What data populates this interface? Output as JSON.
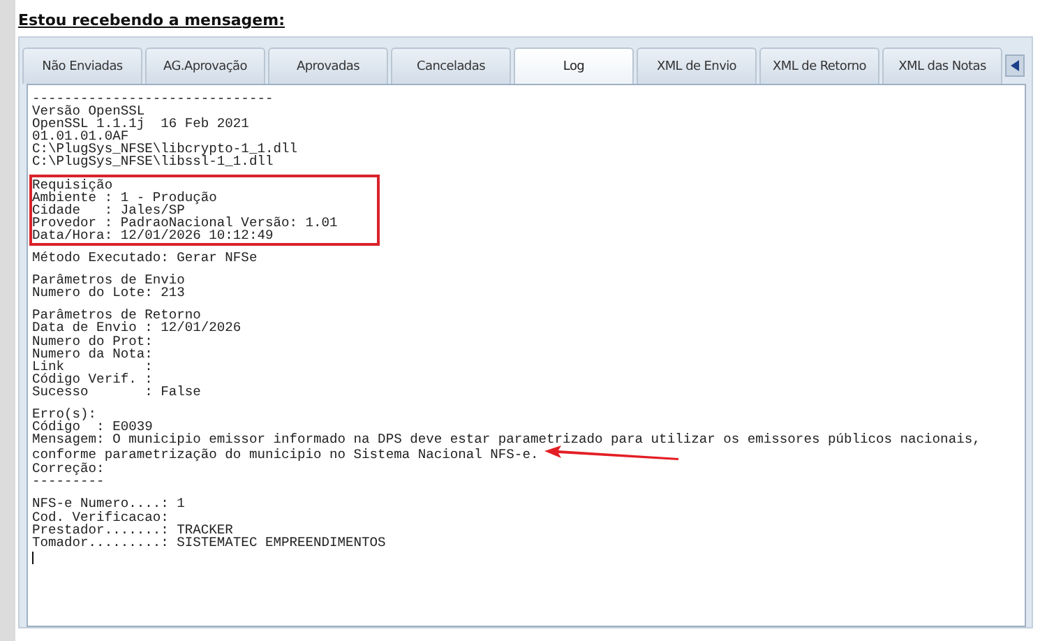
{
  "heading": "Estou recebendo a mensagem:",
  "tabs": [
    {
      "label": "Não Enviadas",
      "selected": false
    },
    {
      "label": "AG.Aprovação",
      "selected": false
    },
    {
      "label": "Aprovadas",
      "selected": false
    },
    {
      "label": "Canceladas",
      "selected": false
    },
    {
      "label": "Log",
      "selected": true
    },
    {
      "label": "XML de Envio",
      "selected": false
    },
    {
      "label": "XML de Retorno",
      "selected": false
    },
    {
      "label": "XML das Notas",
      "selected": false
    }
  ],
  "log": {
    "blocks": [
      {
        "highlighted": false,
        "lines": [
          "------------------------------",
          "Versão OpenSSL",
          "OpenSSL 1.1.1j  16 Feb 2021",
          "01.01.01.0AF",
          "C:\\PlugSys_NFSE\\libcrypto-1_1.dll",
          "C:\\PlugSys_NFSE\\libssl-1_1.dll"
        ]
      },
      {
        "highlighted": true,
        "lines": [
          "Requisição",
          "Ambiente : 1 - Produção",
          "Cidade   : Jales/SP",
          "Provedor : PadraoNacional Versão: 1.01",
          "Data/Hora: 12/01/2026 10:12:49"
        ]
      },
      {
        "highlighted": false,
        "lines": [
          "Método Executado: Gerar NFSe"
        ]
      },
      {
        "highlighted": false,
        "lines": [
          "Parâmetros de Envio",
          "Numero do Lote: 213"
        ]
      },
      {
        "highlighted": false,
        "lines": [
          "Parâmetros de Retorno",
          "Data de Envio : 12/01/2026",
          "Numero do Prot:",
          "Numero da Nota:",
          "Link          :",
          "Código Verif. :",
          "Sucesso       : False"
        ]
      },
      {
        "highlighted": false,
        "lines": [
          "Erro(s):",
          "Código  : E0039",
          "Mensagem: O municipio emissor informado na DPS deve estar parametrizado para utilizar os emissores públicos nacionais,",
          {
            "text": "conforme parametrização do municipio no Sistema Nacional NFS-e.",
            "arrow": true
          },
          "Correção:",
          "---------"
        ]
      },
      {
        "highlighted": false,
        "lines": [
          "NFS-e Numero....: 1",
          "Cod. Verificacao:",
          "Prestador.......: TRACKER",
          "Tomador.........: SISTEMATEC EMPREENDIMENTOS"
        ]
      }
    ]
  }
}
